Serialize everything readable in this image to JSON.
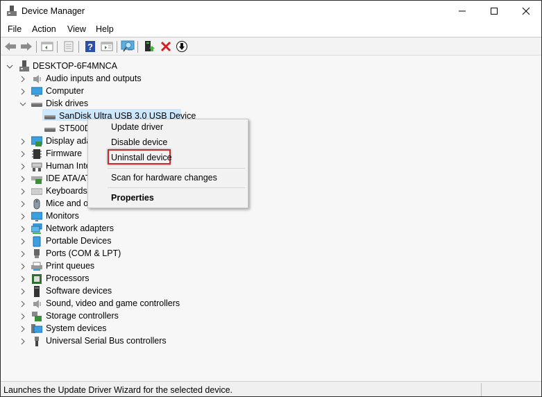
{
  "window": {
    "title": "Device Manager"
  },
  "window_controls": {
    "minimize": "minimize",
    "maximize": "maximize",
    "close": "close"
  },
  "menu": [
    "File",
    "Action",
    "View",
    "Help"
  ],
  "toolbar": [
    "back-icon",
    "forward-icon",
    "show-hide-console-tree-icon",
    "properties-icon",
    "help-icon",
    "show-action-pane-icon",
    "scan-hardware-icon",
    "update-driver-icon",
    "uninstall-icon",
    "disable-device-icon"
  ],
  "tree": {
    "root": "DESKTOP-6F4MNCA",
    "categories": [
      {
        "label": "Audio inputs and outputs",
        "icon": "speaker-icon",
        "expanded": false
      },
      {
        "label": "Computer",
        "icon": "computer-icon",
        "expanded": false
      },
      {
        "label": "Disk drives",
        "icon": "disk-drive-icon",
        "expanded": true,
        "children": [
          {
            "label": "SanDisk Ultra USB 3.0 USB Device",
            "selected": true
          },
          {
            "label": "ST500D",
            "selected": false
          }
        ]
      },
      {
        "label": "Display ada",
        "icon": "display-adapter-icon",
        "expanded": false
      },
      {
        "label": "Firmware",
        "icon": "firmware-icon",
        "expanded": false
      },
      {
        "label": "Human Inte",
        "icon": "hid-icon",
        "expanded": false
      },
      {
        "label": "IDE ATA/AT",
        "icon": "ide-controller-icon",
        "expanded": false
      },
      {
        "label": "Keyboards",
        "icon": "keyboard-icon",
        "expanded": false
      },
      {
        "label": "Mice and o",
        "icon": "mouse-icon",
        "expanded": false
      },
      {
        "label": "Monitors",
        "icon": "monitor-icon",
        "expanded": false
      },
      {
        "label": "Network adapters",
        "icon": "network-adapter-icon",
        "expanded": false
      },
      {
        "label": "Portable Devices",
        "icon": "portable-device-icon",
        "expanded": false
      },
      {
        "label": "Ports (COM & LPT)",
        "icon": "port-icon",
        "expanded": false
      },
      {
        "label": "Print queues",
        "icon": "printer-icon",
        "expanded": false
      },
      {
        "label": "Processors",
        "icon": "processor-icon",
        "expanded": false
      },
      {
        "label": "Software devices",
        "icon": "software-device-icon",
        "expanded": false
      },
      {
        "label": "Sound, video and game controllers",
        "icon": "sound-icon",
        "expanded": false
      },
      {
        "label": "Storage controllers",
        "icon": "storage-controller-icon",
        "expanded": false
      },
      {
        "label": "System devices",
        "icon": "system-device-icon",
        "expanded": false
      },
      {
        "label": "Universal Serial Bus controllers",
        "icon": "usb-icon",
        "expanded": false
      }
    ]
  },
  "context_menu": {
    "items": [
      "Update driver",
      "Disable device",
      "Uninstall device",
      "Scan for hardware changes",
      "Properties"
    ],
    "highlighted": "Uninstall device",
    "highlight_color": "#cc2b2b"
  },
  "status_bar": {
    "text": "Launches the Update Driver Wizard for the selected device."
  }
}
